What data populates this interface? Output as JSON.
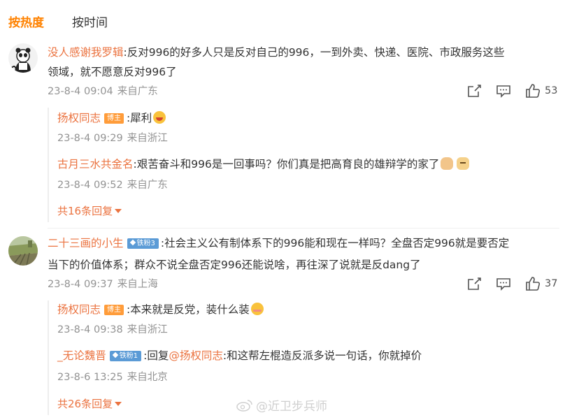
{
  "tabs": [
    "按热度",
    "按时间"
  ],
  "comments": [
    {
      "user": "没人感谢我罗辑",
      "text_line1": ":反对996的好多人只是反对自己的996，一到外卖、快递、医院、市政服务这些",
      "text_line2": "领域，就不愿意反对996了",
      "time": "23-8-4 09:04",
      "source": "来自广东",
      "likes": "53",
      "replies": [
        {
          "user": "扬权同志",
          "badge": "博主",
          "text": ":犀利",
          "emoji": "laughing-emoji",
          "time": "23-8-4 09:29",
          "source": "来自浙江"
        },
        {
          "user": "古月三水共金名",
          "text": ":艰苦奋斗和996是一回事吗？你们真是把高育良的雄辩学的家了",
          "emoji": "hand-emoji",
          "emoji2": "dog-emoji",
          "time": "23-8-4 09:52",
          "source": "来自广东"
        }
      ],
      "more_replies": "共16条回复"
    },
    {
      "user": "二十三画的小生",
      "badge": "铁粉3",
      "text_line1": ":社会主义公有制体系下的996能和现在一样吗？全盘否定996就是要否定",
      "text_line2": "当下的价值体系；群众不说全盘否定996还能说啥，再往深了说就是反dang了",
      "time": "23-8-4 09:37",
      "source": "来自上海",
      "likes": "37",
      "replies": [
        {
          "user": "扬权同志",
          "badge": "博主",
          "text": ":本来就是反党，装什么装",
          "emoji": "shy-emoji",
          "time": "23-8-4 09:38",
          "source": "来自浙江"
        },
        {
          "user": "_无论魏晋",
          "badge": "铁粉1",
          "reply_prefix": ":回复",
          "mention": "@扬权同志",
          "text": ":和这帮左棍造反派多说一句话，你就掉价",
          "time": "23-8-6 13:25",
          "source": "来自北京"
        }
      ],
      "more_replies": "共26条回复"
    }
  ],
  "watermark": "@近卫步兵师",
  "colors": {
    "accent": "#ff8200",
    "username": "#eb7340",
    "meta": "#939393",
    "badge_blogger": "#ff9c3a",
    "badge_fan": "#5b9bd6"
  }
}
